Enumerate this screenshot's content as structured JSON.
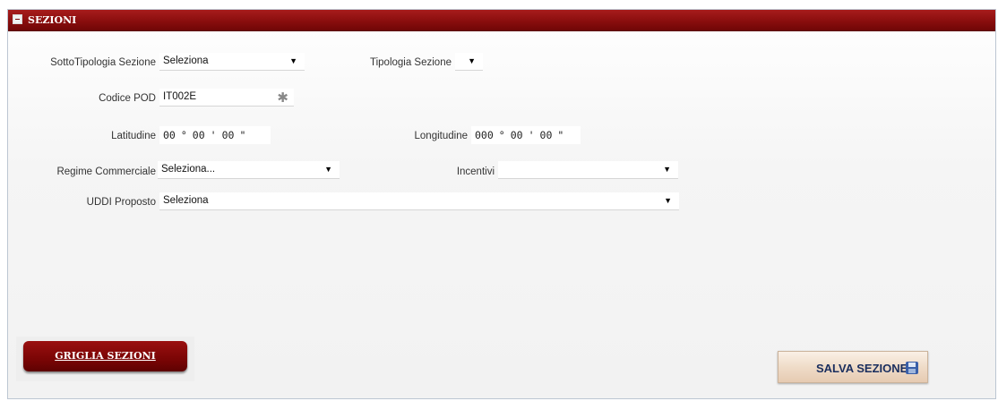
{
  "panel": {
    "title": "SEZIONI"
  },
  "form": {
    "sottotipologia": {
      "label": "SottoTipologia Sezione",
      "value": "Seleziona"
    },
    "tipologia": {
      "label": "Tipologia Sezione",
      "value": ""
    },
    "codice_pod": {
      "label": "Codice POD",
      "value": "IT002E"
    },
    "latitudine": {
      "label": "Latitudine",
      "deg": "00",
      "min": "00",
      "sec": "00",
      "deg_sym": "°",
      "min_sym": "'",
      "sec_sym": "\""
    },
    "longitudine": {
      "label": "Longitudine",
      "deg": "000",
      "min": "00",
      "sec": "00",
      "deg_sym": "°",
      "min_sym": "'",
      "sec_sym": "\""
    },
    "regime": {
      "label": "Regime Commerciale",
      "value": "Seleziona..."
    },
    "incentivi": {
      "label": "Incentivi",
      "value": ""
    },
    "uddi": {
      "label": "UDDI Proposto",
      "value": "Seleziona"
    }
  },
  "icons": {
    "dropdown": "▼",
    "required": "✱"
  },
  "buttons": {
    "griglia": "GRIGLIA SEZIONI",
    "salva": "SALVA SEZIONE"
  },
  "colors": {
    "header": "#8a0e0e",
    "salva_text": "#1a2e5e"
  }
}
